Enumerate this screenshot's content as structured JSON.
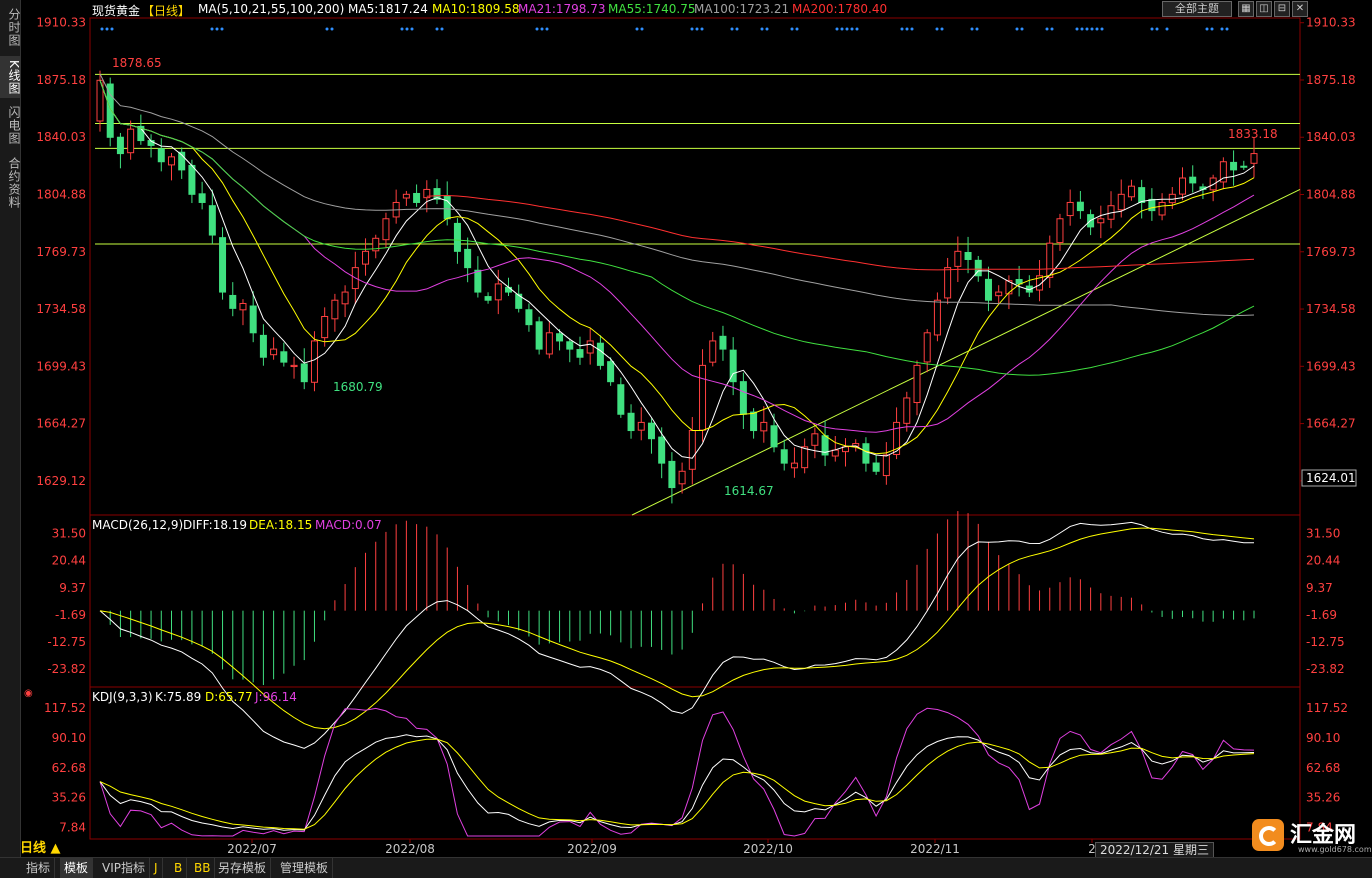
{
  "sidebar": {
    "tabs": [
      {
        "label": "分时图",
        "active": false
      },
      {
        "label": "K线图",
        "active": true
      },
      {
        "label": "闪电图",
        "active": false
      },
      {
        "label": "合约资料",
        "active": false
      }
    ]
  },
  "header": {
    "title": "现货黄金",
    "period_tag": "【日线】",
    "ma_label": "MA(5,10,21,55,100,200)",
    "ma_values": [
      {
        "text": "MA5:1817.24",
        "color": "#ffffff"
      },
      {
        "text": "MA10:1809.58",
        "color": "#ffff00"
      },
      {
        "text": "MA21:1798.73",
        "color": "#e040e0"
      },
      {
        "text": "MA55:1740.75",
        "color": "#40e040"
      },
      {
        "text": "MA100:1723.21",
        "color": "#a0a0a0"
      },
      {
        "text": "MA200:1780.40",
        "color": "#ff3030"
      }
    ],
    "theme_button": "全部主题"
  },
  "price_axis": {
    "ticks": [
      "1910.33",
      "1875.18",
      "1840.03",
      "1804.88",
      "1769.73",
      "1734.58",
      "1699.43",
      "1664.27",
      "1629.12"
    ],
    "current_price": "1624.01"
  },
  "annotations": {
    "high_label": "1878.65",
    "low_label_1": "1680.79",
    "low_label_2": "1614.67",
    "recent_high_label": "1833.18"
  },
  "macd": {
    "label": "MACD(26,12,9)",
    "diff": "DIFF:18.19",
    "dea": "DEA:18.15",
    "macd": "MACD:0.07",
    "ticks": [
      "31.50",
      "20.44",
      "9.37",
      "-1.69",
      "-12.75",
      "-23.82"
    ]
  },
  "kdj": {
    "label": "KDJ(9,3,3)",
    "k": "K:75.89",
    "d": "D:65.77",
    "j": "J:96.14",
    "ticks": [
      "117.52",
      "90.10",
      "62.68",
      "35.26",
      "7.84"
    ]
  },
  "time_axis": {
    "labels": [
      "2022/07",
      "2022/08",
      "2022/09",
      "2022/10",
      "2022/11",
      "2"
    ],
    "cursor_date": "2022/12/21 星期三"
  },
  "period_label": "日线 ▲",
  "bottom_tabs": [
    {
      "label": "指标",
      "active": false
    },
    {
      "label": "模板",
      "active": true
    },
    {
      "label": "VIP指标",
      "active": false
    },
    {
      "label": "J",
      "active": false
    },
    {
      "label": "B",
      "active": false
    },
    {
      "label": "BB",
      "active": false
    },
    {
      "label": "另存模板",
      "active": false
    },
    {
      "label": "管理模板",
      "active": false
    }
  ],
  "logo": {
    "text": "汇金网",
    "url": "www.gold678.com"
  },
  "colors": {
    "up": "#ff4040",
    "down": "#40e080",
    "grid": "#8a0000"
  },
  "chart_data": {
    "type": "candlestick",
    "price_range": [
      1610,
      1912
    ],
    "x_months": [
      "2022/07",
      "2022/08",
      "2022/09",
      "2022/10",
      "2022/11",
      "2022/12"
    ],
    "close_path": [
      1875,
      1840,
      1830,
      1845,
      1838,
      1835,
      1825,
      1828,
      1820,
      1805,
      1800,
      1780,
      1745,
      1735,
      1738,
      1720,
      1705,
      1710,
      1702,
      1700,
      1690,
      1715,
      1730,
      1740,
      1745,
      1760,
      1770,
      1778,
      1790,
      1800,
      1805,
      1800,
      1808,
      1802,
      1790,
      1770,
      1760,
      1745,
      1740,
      1750,
      1745,
      1735,
      1725,
      1710,
      1720,
      1715,
      1710,
      1705,
      1715,
      1700,
      1690,
      1670,
      1660,
      1665,
      1655,
      1640,
      1625,
      1635,
      1660,
      1700,
      1715,
      1710,
      1690,
      1670,
      1660,
      1665,
      1650,
      1640,
      1640,
      1650,
      1658,
      1645,
      1648,
      1650,
      1652,
      1640,
      1635,
      1645,
      1665,
      1680,
      1700,
      1720,
      1740,
      1760,
      1770,
      1765,
      1755,
      1740,
      1745,
      1752,
      1750,
      1745,
      1755,
      1775,
      1790,
      1800,
      1795,
      1785,
      1790,
      1798,
      1805,
      1810,
      1800,
      1795,
      1800,
      1805,
      1815,
      1812,
      1808,
      1815,
      1825,
      1820,
      1822,
      1830
    ]
  }
}
